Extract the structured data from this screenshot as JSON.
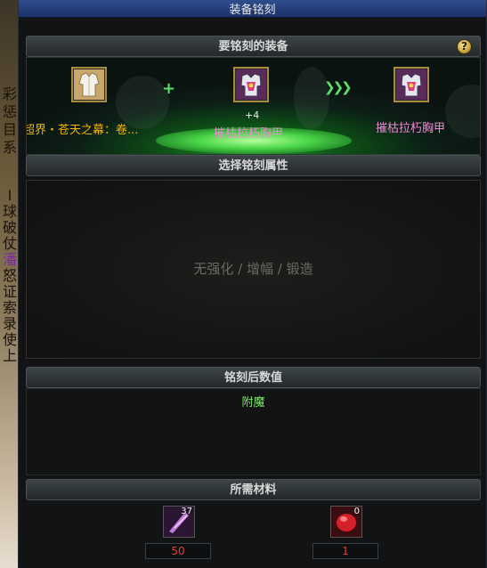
{
  "window": {
    "title": "装备铭刻"
  },
  "background_strip": {
    "glyphs": [
      "彩",
      "惩",
      "目",
      "系",
      "",
      "",
      "",
      "",
      "",
      "I",
      "球",
      "破",
      "仗",
      "潘",
      "怒",
      "证",
      "索",
      "录",
      "使",
      "上"
    ]
  },
  "equip_section": {
    "header": "要铭刻的装备",
    "help_icon": "?",
    "source_item": {
      "name": "超界・苍天之幕：卷...",
      "icon": "white-robe-icon"
    },
    "plus_icon": "+",
    "arrows_icon": "❯❯❯",
    "target_item": {
      "level": "+4",
      "name": "摧枯拉朽胸甲",
      "icon": "chest-armor-icon"
    },
    "result_item": {
      "name": "摧枯拉朽胸甲",
      "icon": "chest-armor-icon"
    }
  },
  "attr_section": {
    "header": "选择铭刻属性",
    "placeholder": "无强化 / 增幅 / 锻造"
  },
  "result_section": {
    "header": "铭刻后数值",
    "value": "附魔"
  },
  "materials_section": {
    "header": "所需材料",
    "items": [
      {
        "icon": "purple-crystal-shard-icon",
        "owned": "37",
        "required": "50"
      },
      {
        "icon": "red-gem-icon",
        "owned": "0",
        "required": "1"
      }
    ]
  }
}
